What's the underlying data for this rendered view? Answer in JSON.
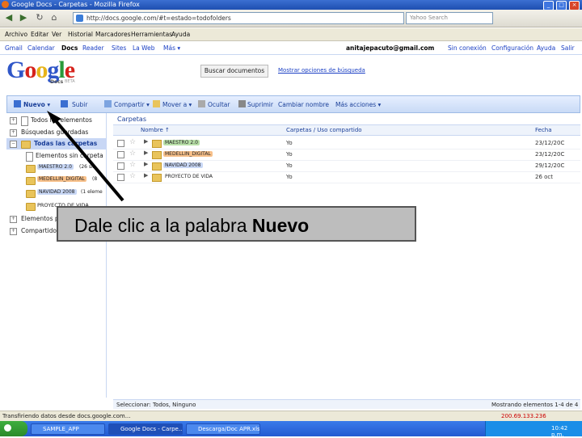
{
  "window": {
    "title": "Google Docs - Carpetas - Mozilla Firefox"
  },
  "nav": {
    "url": "http://docs.google.com/#t=estado=todofolders",
    "search_placeholder": "Yahoo Search"
  },
  "menu": [
    "Archivo",
    "Editar",
    "Ver",
    "Historial",
    "Marcadores",
    "Herramientas",
    "Ayuda"
  ],
  "gbar": {
    "links": [
      "Gmail",
      "Calendar",
      "Docs",
      "Reader",
      "Sites",
      "La Web",
      "Más ▾"
    ],
    "right": [
      "anitajepacuto@gmail.com",
      "Sin conexión",
      "Configuración",
      "Ayuda",
      "Salir"
    ]
  },
  "brand": {
    "logo": "Google",
    "sub": "Docs",
    "beta": "BETA"
  },
  "search": {
    "button": "Buscar documentos",
    "options": "Mostrar opciones de búsqueda"
  },
  "toolbar": {
    "new": "Nuevo ▾",
    "upload": "Subir",
    "share": "Compartir ▾",
    "move": "Mover a ▾",
    "hide": "Ocultar",
    "delete": "Suprimir",
    "rename": "Cambiar nombre",
    "more": "Más acciones ▾"
  },
  "sidebar": {
    "all_items": "Todos los elementos",
    "saved_searches": "Búsquedas guardadas",
    "all_folders": "Todas las carpetas",
    "items": [
      {
        "label": "Elementos sin carpeta",
        "type": "doc"
      },
      {
        "label": "MAESTRO 2.0",
        "suffix": "(26 sin",
        "tag": "#c8d7f5"
      },
      {
        "label": "MEDELLIN_DIGITAL",
        "suffix": "(8",
        "tag": "#f7c08a"
      },
      {
        "label": "NAVIDAD 2008",
        "suffix": "(1 eleme",
        "tag": "#c8d7f5"
      },
      {
        "label": "PROYECTO DE VIDA",
        "suffix": "",
        "tag": ""
      }
    ],
    "shared_items": "Elementos por tipo",
    "shared_with": "Compartido con"
  },
  "main": {
    "breadcrumb": "Carpetas",
    "columns": {
      "name": "Nombre ↑",
      "folders": "Carpetas / Uso compartido",
      "date": "Fecha"
    },
    "rows": [
      {
        "name": "MAESTRO 2.0",
        "share": "Yo",
        "date": "23/12/20C",
        "tag": "#b8e0a8"
      },
      {
        "name": "MEDELLIN_DIGITAL",
        "share": "Yo",
        "date": "23/12/20C",
        "tag": "#f7c08a"
      },
      {
        "name": "NAVIDAD 2008",
        "share": "Yo",
        "date": "29/12/20C",
        "tag": "#c8d7f5"
      },
      {
        "name": "PROYECTO DE VIDA",
        "share": "Yo",
        "date": "26 oct",
        "tag": ""
      }
    ],
    "footer_left": "Seleccionar: Todos, Ninguno",
    "footer_right": "Mostrando elementos 1-4 de 4"
  },
  "status": {
    "text": "Transfiriendo datos desde docs.google.com...",
    "ip": "200.69.133.236"
  },
  "taskbar": {
    "start": "Inicio",
    "tasks": [
      "SAMPLE_APP",
      "Google Docs - Carpe...",
      "Descarga/Doc APR.xls"
    ],
    "clock": "10:42 p.m."
  },
  "callout": {
    "prefix": "Dale clic a la palabra ",
    "bold": "Nuevo"
  },
  "colors": {
    "toolbar_blue": "#c9dbf6",
    "accent": "#1a3f99",
    "folder": "#e9c45b"
  }
}
